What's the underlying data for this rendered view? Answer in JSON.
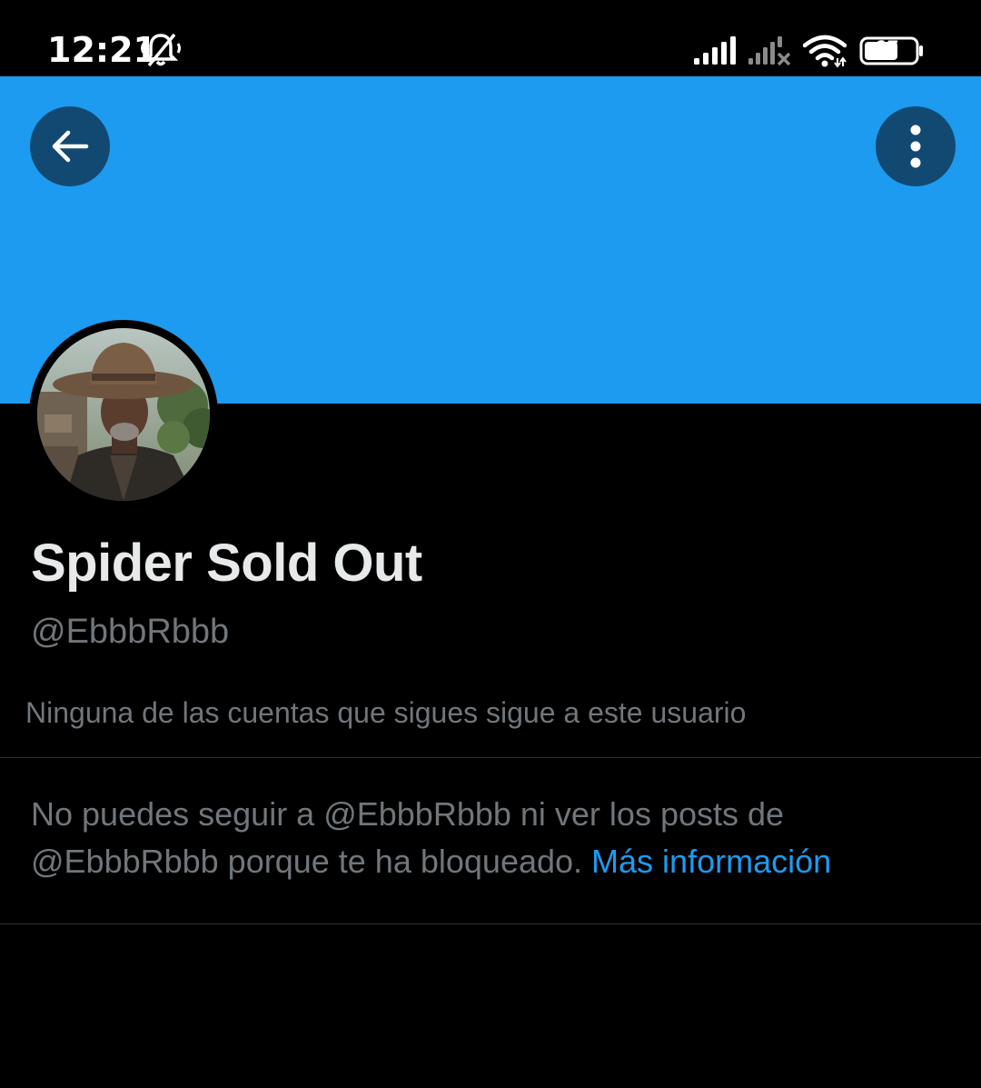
{
  "status_bar": {
    "time": "12:21",
    "battery_level": "67",
    "icons": [
      "bell-muted-icon",
      "signal-icon",
      "signal-no-service-icon",
      "wifi-icon",
      "battery-icon"
    ]
  },
  "colors": {
    "banner": "#1d9bf0",
    "background": "#000000",
    "primary_text": "#e7e9ea",
    "secondary_text": "#71767b",
    "link": "#1d9bf0",
    "divider": "#2f3336",
    "round_button_bg": "#0f3250"
  },
  "header": {
    "back_icon": "arrow-left-icon",
    "more_icon": "more-vertical-icon"
  },
  "profile": {
    "display_name": "Spider Sold Out",
    "handle": "@EbbbRbbb",
    "followers_note": "Ninguna de las cuentas que sigues sigue a este usuario"
  },
  "blocked": {
    "message": "No puedes seguir a @EbbbRbbb ni ver los posts de @EbbbRbbb porque te ha bloqueado.",
    "link_label": "Más información"
  }
}
